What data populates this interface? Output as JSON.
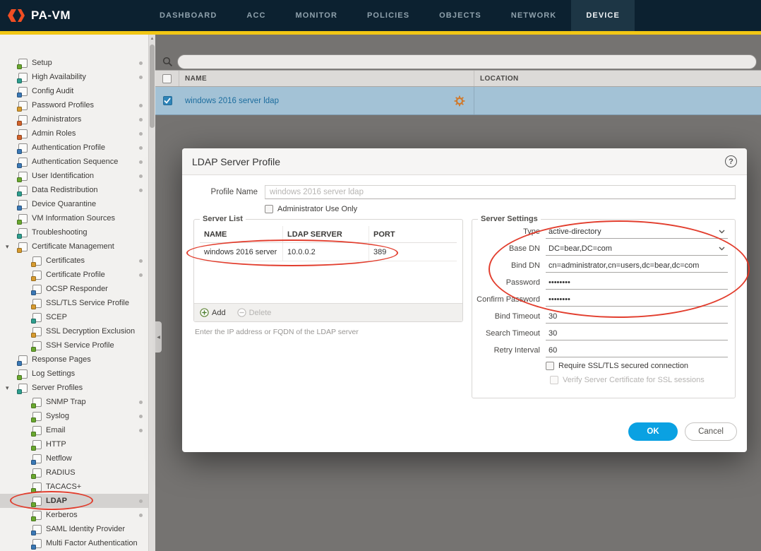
{
  "colors": {
    "brand_orange": "#f04e23",
    "accent_yellow": "#f2c714",
    "ok_blue": "#0aa1e2",
    "annotation_red": "#e03423",
    "selected_row_blue": "#a3c2d6"
  },
  "header": {
    "logo_text": "PA-VM",
    "nav": [
      {
        "label": "DASHBOARD",
        "active": false
      },
      {
        "label": "ACC",
        "active": false
      },
      {
        "label": "MONITOR",
        "active": false
      },
      {
        "label": "POLICIES",
        "active": false
      },
      {
        "label": "OBJECTS",
        "active": false
      },
      {
        "label": "NETWORK",
        "active": false
      },
      {
        "label": "DEVICE",
        "active": true
      }
    ]
  },
  "sidebar": {
    "items": [
      {
        "label": "Setup",
        "level": 0,
        "dot": true,
        "color": "#69a82f"
      },
      {
        "label": "High Availability",
        "level": 0,
        "dot": true,
        "color": "#2e9e8e"
      },
      {
        "label": "Config Audit",
        "level": 0,
        "dot": false,
        "color": "#3a78b5"
      },
      {
        "label": "Password Profiles",
        "level": 0,
        "dot": true,
        "color": "#d79b2f"
      },
      {
        "label": "Administrators",
        "level": 0,
        "dot": true,
        "color": "#d2622a"
      },
      {
        "label": "Admin Roles",
        "level": 0,
        "dot": true,
        "color": "#d2622a"
      },
      {
        "label": "Authentication Profile",
        "level": 0,
        "dot": true,
        "color": "#3a78b5"
      },
      {
        "label": "Authentication Sequence",
        "level": 0,
        "dot": true,
        "color": "#3a78b5"
      },
      {
        "label": "User Identification",
        "level": 0,
        "dot": true,
        "color": "#69a82f"
      },
      {
        "label": "Data Redistribution",
        "level": 0,
        "dot": true,
        "color": "#2e9e8e"
      },
      {
        "label": "Device Quarantine",
        "level": 0,
        "dot": false,
        "color": "#3a78b5"
      },
      {
        "label": "VM Information Sources",
        "level": 0,
        "dot": false,
        "color": "#69a82f"
      },
      {
        "label": "Troubleshooting",
        "level": 0,
        "dot": false,
        "color": "#2e9e8e"
      },
      {
        "label": "Certificate Management",
        "level": 0,
        "dot": false,
        "expanded": true,
        "color": "#d79b2f"
      },
      {
        "label": "Certificates",
        "level": 1,
        "dot": true,
        "color": "#d79b2f"
      },
      {
        "label": "Certificate Profile",
        "level": 1,
        "dot": true,
        "color": "#d79b2f"
      },
      {
        "label": "OCSP Responder",
        "level": 1,
        "dot": false,
        "color": "#3a78b5"
      },
      {
        "label": "SSL/TLS Service Profile",
        "level": 1,
        "dot": false,
        "color": "#d79b2f"
      },
      {
        "label": "SCEP",
        "level": 1,
        "dot": false,
        "color": "#2e9e8e"
      },
      {
        "label": "SSL Decryption Exclusion",
        "level": 1,
        "dot": false,
        "color": "#d79b2f"
      },
      {
        "label": "SSH Service Profile",
        "level": 1,
        "dot": false,
        "color": "#69a82f"
      },
      {
        "label": "Response Pages",
        "level": 0,
        "dot": false,
        "color": "#3a78b5"
      },
      {
        "label": "Log Settings",
        "level": 0,
        "dot": false,
        "color": "#69a82f"
      },
      {
        "label": "Server Profiles",
        "level": 0,
        "dot": false,
        "expanded": true,
        "color": "#2e9e8e"
      },
      {
        "label": "SNMP Trap",
        "level": 1,
        "dot": true,
        "color": "#69a82f"
      },
      {
        "label": "Syslog",
        "level": 1,
        "dot": true,
        "color": "#69a82f"
      },
      {
        "label": "Email",
        "level": 1,
        "dot": true,
        "color": "#69a82f"
      },
      {
        "label": "HTTP",
        "level": 1,
        "dot": false,
        "color": "#69a82f"
      },
      {
        "label": "Netflow",
        "level": 1,
        "dot": false,
        "color": "#3a78b5"
      },
      {
        "label": "RADIUS",
        "level": 1,
        "dot": false,
        "color": "#69a82f"
      },
      {
        "label": "TACACS+",
        "level": 1,
        "dot": false,
        "color": "#69a82f"
      },
      {
        "label": "LDAP",
        "level": 1,
        "dot": true,
        "selected": true,
        "annotated": true,
        "color": "#69a82f"
      },
      {
        "label": "Kerberos",
        "level": 1,
        "dot": true,
        "color": "#69a82f"
      },
      {
        "label": "SAML Identity Provider",
        "level": 1,
        "dot": false,
        "color": "#3a78b5"
      },
      {
        "label": "Multi Factor Authentication",
        "level": 1,
        "dot": false,
        "color": "#3a78b5"
      }
    ]
  },
  "content": {
    "search": {
      "placeholder": ""
    },
    "table": {
      "columns": [
        "NAME",
        "LOCATION"
      ],
      "rows": [
        {
          "name": "windows 2016 server ldap",
          "location": "",
          "checked": true
        }
      ]
    }
  },
  "modal": {
    "title": "LDAP Server Profile",
    "profile_name_label": "Profile Name",
    "profile_name_value": "windows 2016 server ldap",
    "admin_only_label": "Administrator Use Only",
    "server_list": {
      "legend": "Server List",
      "columns": [
        "NAME",
        "LDAP SERVER",
        "PORT"
      ],
      "rows": [
        [
          "windows 2016 server",
          "10.0.0.2",
          "389"
        ]
      ],
      "add_label": "Add",
      "delete_label": "Delete",
      "hint": "Enter the IP address or FQDN of the LDAP server"
    },
    "server_settings": {
      "legend": "Server Settings",
      "fields": [
        {
          "label": "Type",
          "value": "active-directory",
          "control": "select"
        },
        {
          "label": "Base DN",
          "value": "DC=bear,DC=com",
          "control": "select"
        },
        {
          "label": "Bind DN",
          "value": "cn=administrator,cn=users,dc=bear,dc=com",
          "control": "text"
        },
        {
          "label": "Password",
          "value": "••••••••",
          "control": "text"
        },
        {
          "label": "Confirm Password",
          "value": "••••••••",
          "control": "text"
        },
        {
          "label": "Bind Timeout",
          "value": "30",
          "control": "text"
        },
        {
          "label": "Search Timeout",
          "value": "30",
          "control": "text"
        },
        {
          "label": "Retry Interval",
          "value": "60",
          "control": "text"
        }
      ],
      "checkboxes": [
        {
          "label": "Require SSL/TLS secured connection",
          "checked": false,
          "disabled": false
        },
        {
          "label": "Verify Server Certificate for SSL sessions",
          "checked": false,
          "disabled": true
        }
      ]
    },
    "ok_label": "OK",
    "cancel_label": "Cancel"
  }
}
